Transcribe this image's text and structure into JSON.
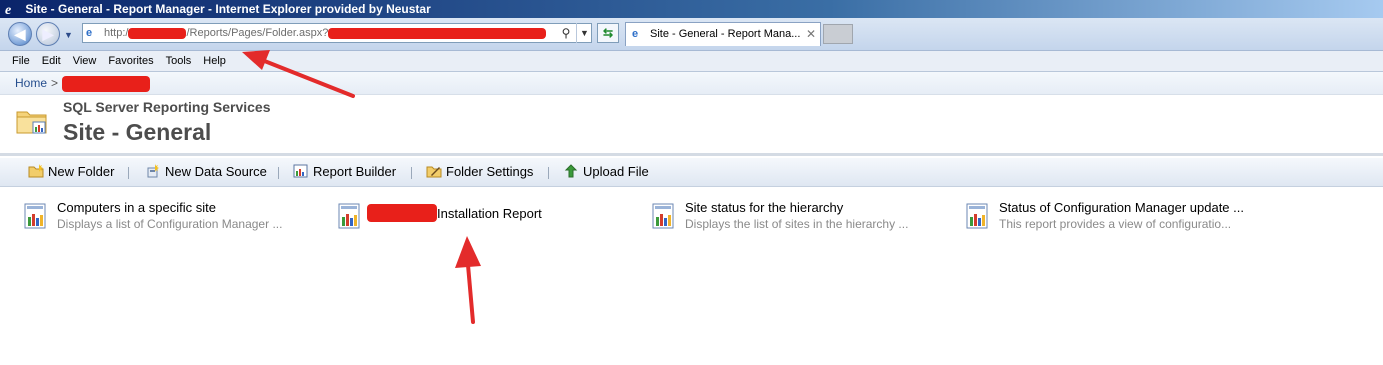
{
  "window": {
    "title": "Site - General - Report Manager - Internet Explorer provided by Neustar"
  },
  "addressbar": {
    "url_prefix": "http:/",
    "url_middle": "/Reports/Pages/Folder.aspx?"
  },
  "tab": {
    "label": "Site - General - Report Mana...",
    "close": "✕"
  },
  "menu": [
    "File",
    "Edit",
    "View",
    "Favorites",
    "Tools",
    "Help"
  ],
  "breadcrumb": {
    "home": "Home",
    "separator": ">"
  },
  "header": {
    "subtitle": "SQL Server Reporting Services",
    "title": "Site - General"
  },
  "toolbar": {
    "new_folder": "New Folder",
    "new_data_source": "New Data Source",
    "report_builder": "Report Builder",
    "folder_settings": "Folder Settings",
    "upload_file": "Upload File"
  },
  "reports": [
    {
      "name": "Computers in a specific site",
      "desc": "Displays a list of Configuration Manager ..."
    },
    {
      "name": "Installation Report",
      "desc": ""
    },
    {
      "name": "Site status for the hierarchy",
      "desc": "Displays the list of sites in the hierarchy ..."
    },
    {
      "name": "Status of Configuration Manager update ...",
      "desc": "This report provides a view of configuratio..."
    }
  ],
  "colors": {
    "redaction": "#e8201a",
    "annotation_arrow": "#e32b2b",
    "title_text": "#4d4d4d"
  }
}
